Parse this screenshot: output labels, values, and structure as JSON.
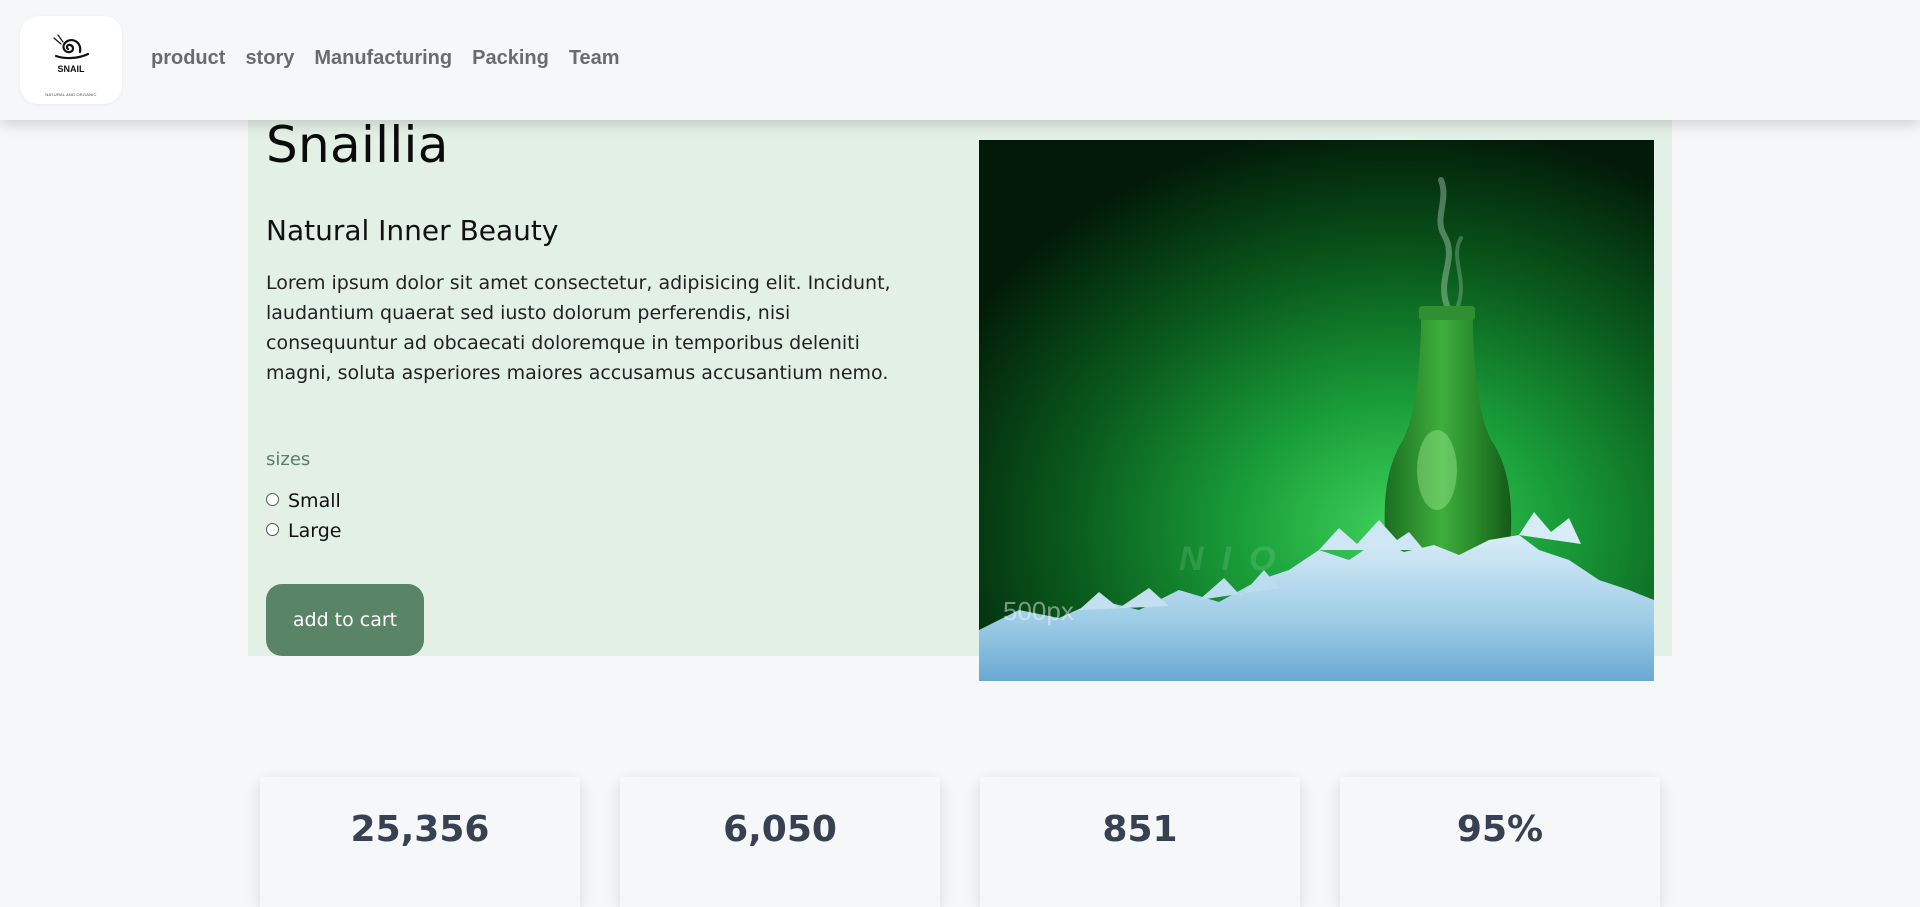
{
  "brand": {
    "logo_word": "SNAIL",
    "logo_tagline": "NATURAL AND ORGANIC"
  },
  "nav": {
    "items": [
      {
        "label": "product"
      },
      {
        "label": "story"
      },
      {
        "label": "Manufacturing"
      },
      {
        "label": "Packing"
      },
      {
        "label": "Team"
      }
    ]
  },
  "product": {
    "title": "Snaillia",
    "subtitle": "Natural Inner Beauty",
    "description": "Lorem ipsum dolor sit amet consectetur, adipisicing elit. Incidunt, laudantium quaerat sed iusto dolorum perferendis, nisi consequuntur ad obcaecati doloremque in temporibus deleniti magni, soluta asperiores maiores accusamus accusantium nemo.",
    "sizes_label": "sizes",
    "sizes": [
      {
        "label": "Small",
        "selected": false
      },
      {
        "label": "Large",
        "selected": false
      }
    ],
    "cta_label": "add to cart",
    "image_watermark": "500px"
  },
  "stats": [
    {
      "value": "25,356"
    },
    {
      "value": "6,050"
    },
    {
      "value": "851"
    },
    {
      "value": "95%"
    }
  ],
  "colors": {
    "page_bg": "#f6f7f9",
    "hero_bg": "#e3f0e6",
    "button_bg": "#5a8467",
    "nav_text": "#6b6b6b",
    "stat_text": "#374151",
    "sizes_label": "#5f7d66"
  }
}
